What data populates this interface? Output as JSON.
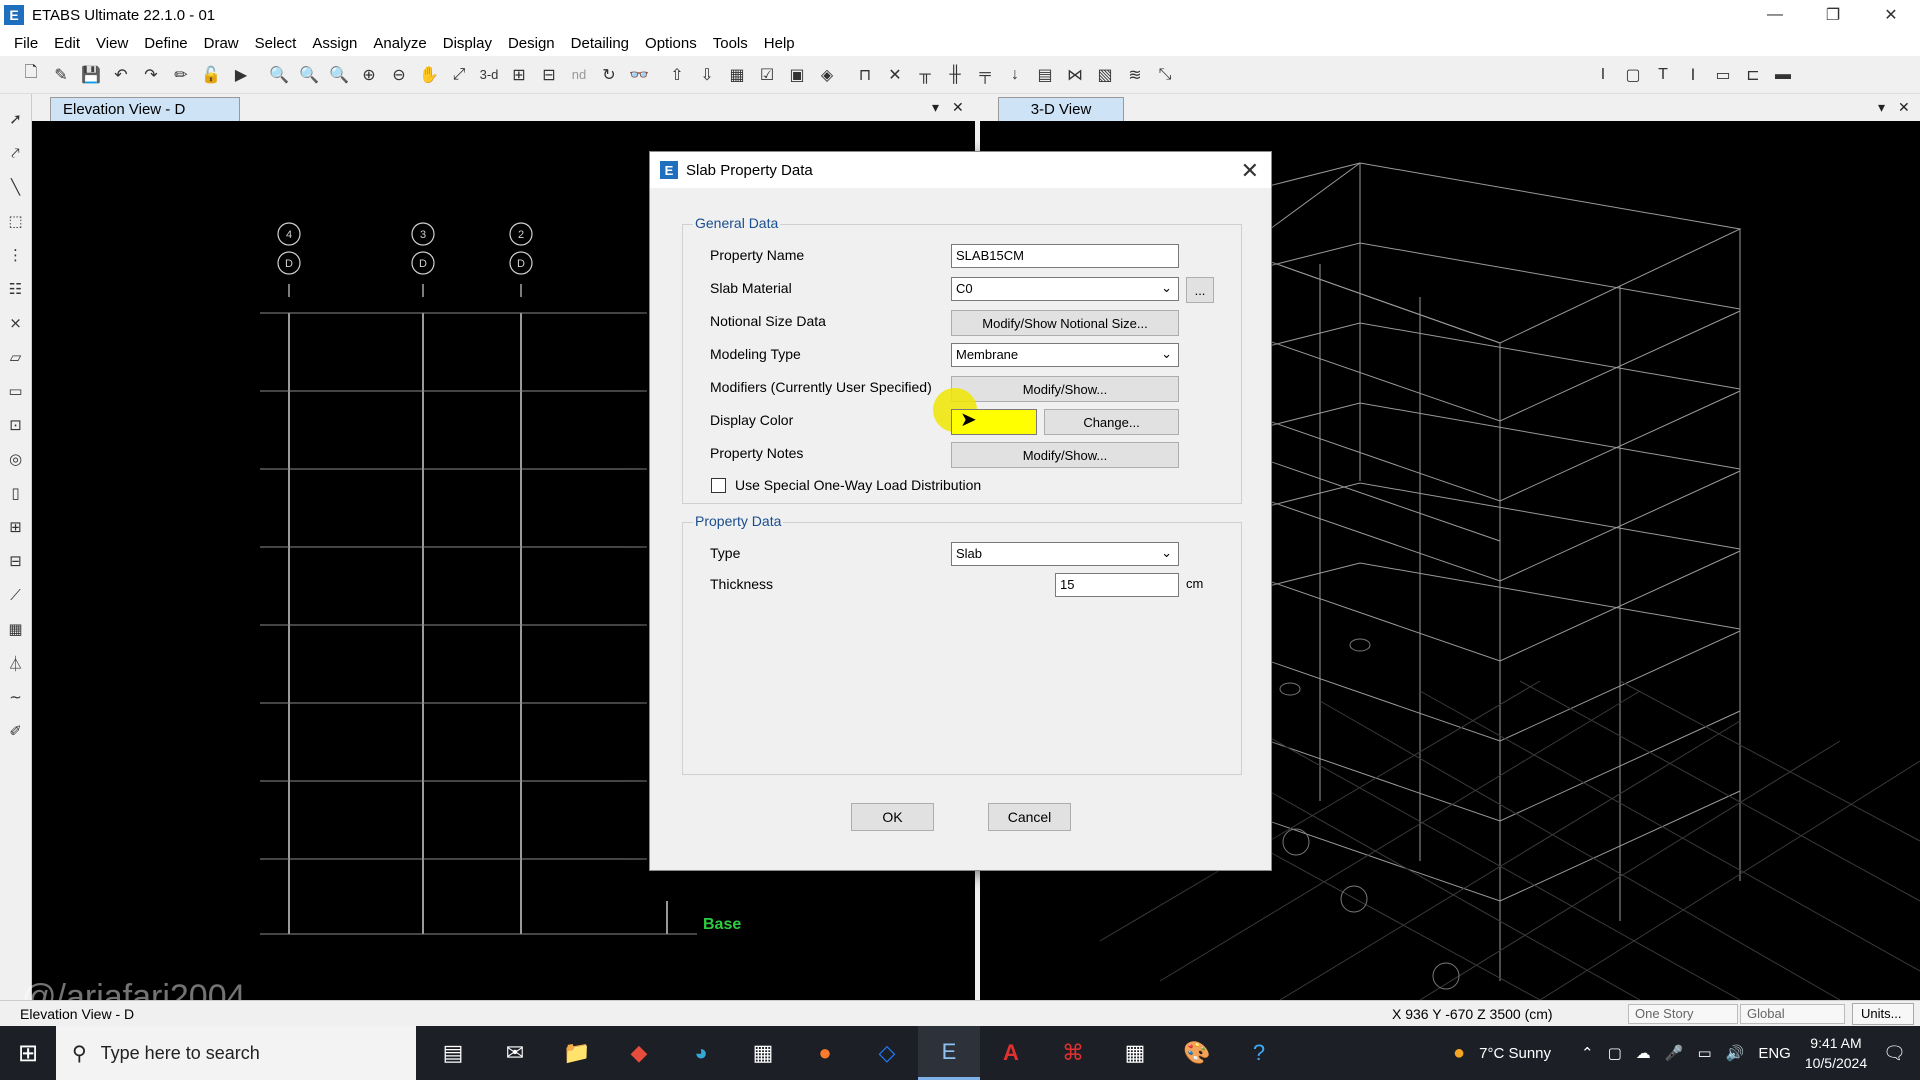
{
  "window": {
    "title": "ETABS Ultimate 22.1.0 - 01",
    "app_icon": "E",
    "minimize": "—",
    "restore": "❐",
    "close": "✕"
  },
  "menu": [
    "File",
    "Edit",
    "View",
    "Define",
    "Draw",
    "Select",
    "Assign",
    "Analyze",
    "Display",
    "Design",
    "Detailing",
    "Options",
    "Tools",
    "Help"
  ],
  "toolbar": {
    "label_3d": "3-d",
    "label_nd": "nd"
  },
  "tabs": {
    "left": {
      "label": "Elevation View - D",
      "dropdown": "▾",
      "close": "✕"
    },
    "right": {
      "label": "3-D View",
      "dropdown": "▾",
      "close": "✕"
    }
  },
  "elevation": {
    "grid_bubbles": [
      {
        "top": "4",
        "bottom": "D"
      },
      {
        "top": "3",
        "bottom": "D"
      },
      {
        "top": "2",
        "bottom": "D"
      }
    ],
    "base_label": "Base"
  },
  "watermark": "@/ariafari2004",
  "dialog": {
    "title": "Slab Property Data",
    "icon": "E",
    "close": "✕",
    "general": {
      "label": "General Data",
      "property_name_label": "Property Name",
      "property_name_value": "SLAB15CM",
      "slab_material_label": "Slab Material",
      "slab_material_value": "C0",
      "slab_material_more": "...",
      "notional_label": "Notional Size Data",
      "notional_button": "Modify/Show Notional Size...",
      "modeling_label": "Modeling Type",
      "modeling_value": "Membrane",
      "modifiers_label": "Modifiers (Currently User Specified)",
      "modifiers_button": "Modify/Show...",
      "color_label": "Display Color",
      "color_value": "#ffff00",
      "color_button": "Change...",
      "notes_label": "Property Notes",
      "notes_button": "Modify/Show...",
      "oneway_label": "Use Special One-Way Load Distribution"
    },
    "property": {
      "label": "Property Data",
      "type_label": "Type",
      "type_value": "Slab",
      "thickness_label": "Thickness",
      "thickness_value": "15",
      "thickness_unit": "cm"
    },
    "ok": "OK",
    "cancel": "Cancel"
  },
  "status": {
    "view": "Elevation View - D",
    "coords": "X 936  Y -670  Z 3500 (cm)",
    "story": "One Story",
    "coord_sys": "Global",
    "units": "Units..."
  },
  "taskbar": {
    "search_placeholder": "Type here to search",
    "weather": "7°C  Sunny",
    "lang": "ENG",
    "time": "9:41 AM",
    "date": "10/5/2024"
  }
}
